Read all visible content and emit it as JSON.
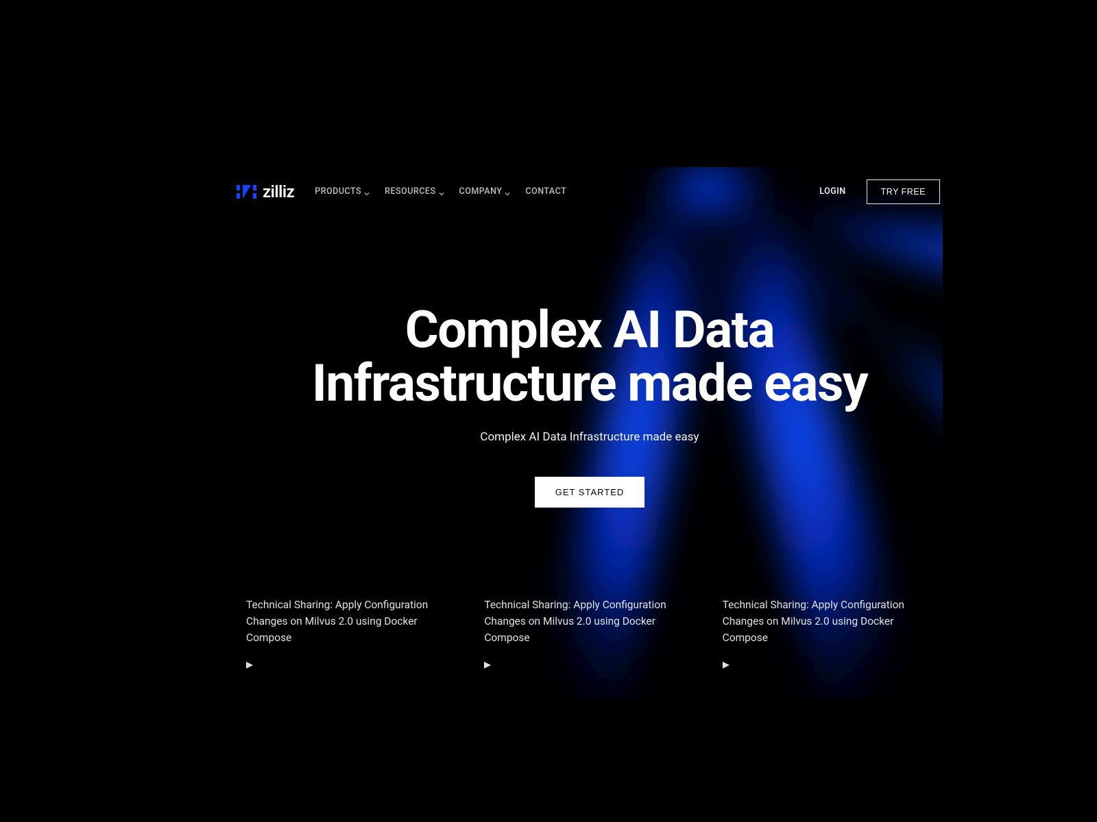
{
  "brand": {
    "name": "zilliz"
  },
  "nav": {
    "items": [
      {
        "label": "PRODUCTS",
        "has_dropdown": true
      },
      {
        "label": "RESOURCES",
        "has_dropdown": true
      },
      {
        "label": "COMPANY",
        "has_dropdown": true
      },
      {
        "label": "CONTACT",
        "has_dropdown": false
      }
    ],
    "login": "LOGIN",
    "try_free": "TRY FREE"
  },
  "hero": {
    "title_line1": "Complex AI Data",
    "title_line2": "Infrastructure made easy",
    "subtitle": "Complex AI Data Infrastructure made easy",
    "cta": "GET STARTED"
  },
  "articles": [
    {
      "title": "Technical Sharing: Apply Configuration Changes on Milvus 2.0 using Docker Compose"
    },
    {
      "title": "Technical Sharing: Apply Configuration Changes on Milvus 2.0 using Docker Compose"
    },
    {
      "title": "Technical Sharing: Apply Configuration Changes on Milvus 2.0 using Docker Compose"
    }
  ],
  "colors": {
    "accent": "#0a3fff",
    "ray": "#0530e0"
  }
}
